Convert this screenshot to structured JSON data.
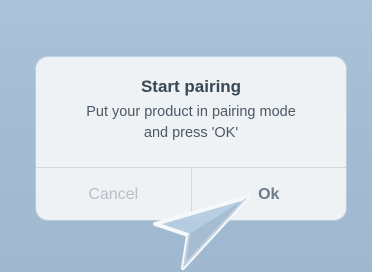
{
  "dialog": {
    "title": "Start pairing",
    "message_line1": "Put your product in pairing mode",
    "message_line2": "and press 'OK'",
    "cancel_label": "Cancel",
    "ok_label": "Ok"
  },
  "colors": {
    "background": "#a9c1d7",
    "dialog": "#eef2f5",
    "title": "#3a4856",
    "cancel": "#b7bec5",
    "ok": "#6f7c89"
  },
  "icons": {
    "pointer": "arrow-pointer-icon"
  }
}
